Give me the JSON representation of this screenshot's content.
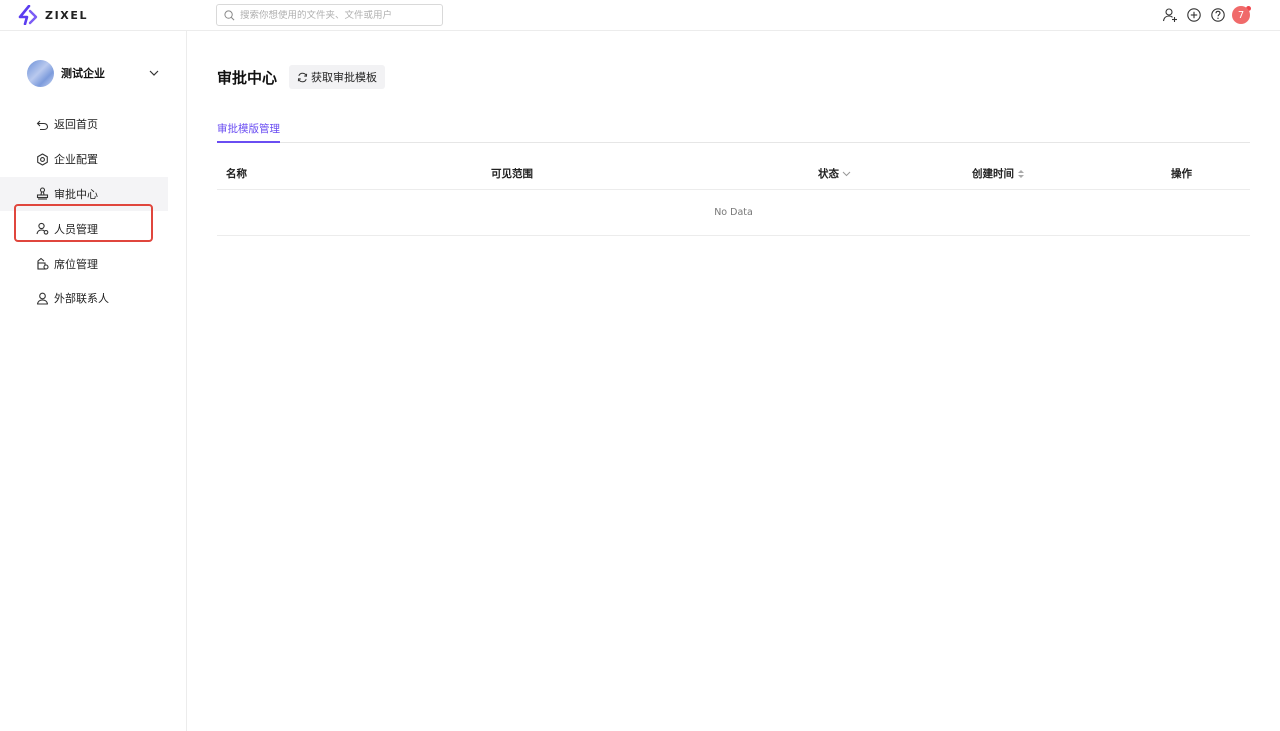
{
  "brand": {
    "name": "ZIXEL",
    "accent": "#6a4df2"
  },
  "search": {
    "placeholder": "搜索你想使用的文件夹、文件或用户"
  },
  "topbar": {
    "icons": [
      "add-user-icon",
      "plus-circle-icon",
      "help-icon",
      "bell-icon"
    ],
    "avatar_badge": "7"
  },
  "sidebar": {
    "org_name": "测试企业",
    "items": [
      {
        "label": "返回首页",
        "icon": "back-arrow-icon"
      },
      {
        "label": "企业配置",
        "icon": "gear-icon"
      },
      {
        "label": "审批中心",
        "icon": "stamp-icon",
        "active": true
      },
      {
        "label": "人员管理",
        "icon": "users-icon"
      },
      {
        "label": "席位管理",
        "icon": "seat-icon"
      },
      {
        "label": "外部联系人",
        "icon": "contact-icon"
      }
    ]
  },
  "main": {
    "title": "审批中心",
    "fetch_button": "获取审批模板",
    "tabs": [
      {
        "label": "审批模版管理",
        "active": true
      }
    ],
    "table": {
      "columns": [
        "名称",
        "可见范围",
        "状态",
        "创建时间",
        "操作"
      ],
      "empty_text": "No Data"
    }
  }
}
